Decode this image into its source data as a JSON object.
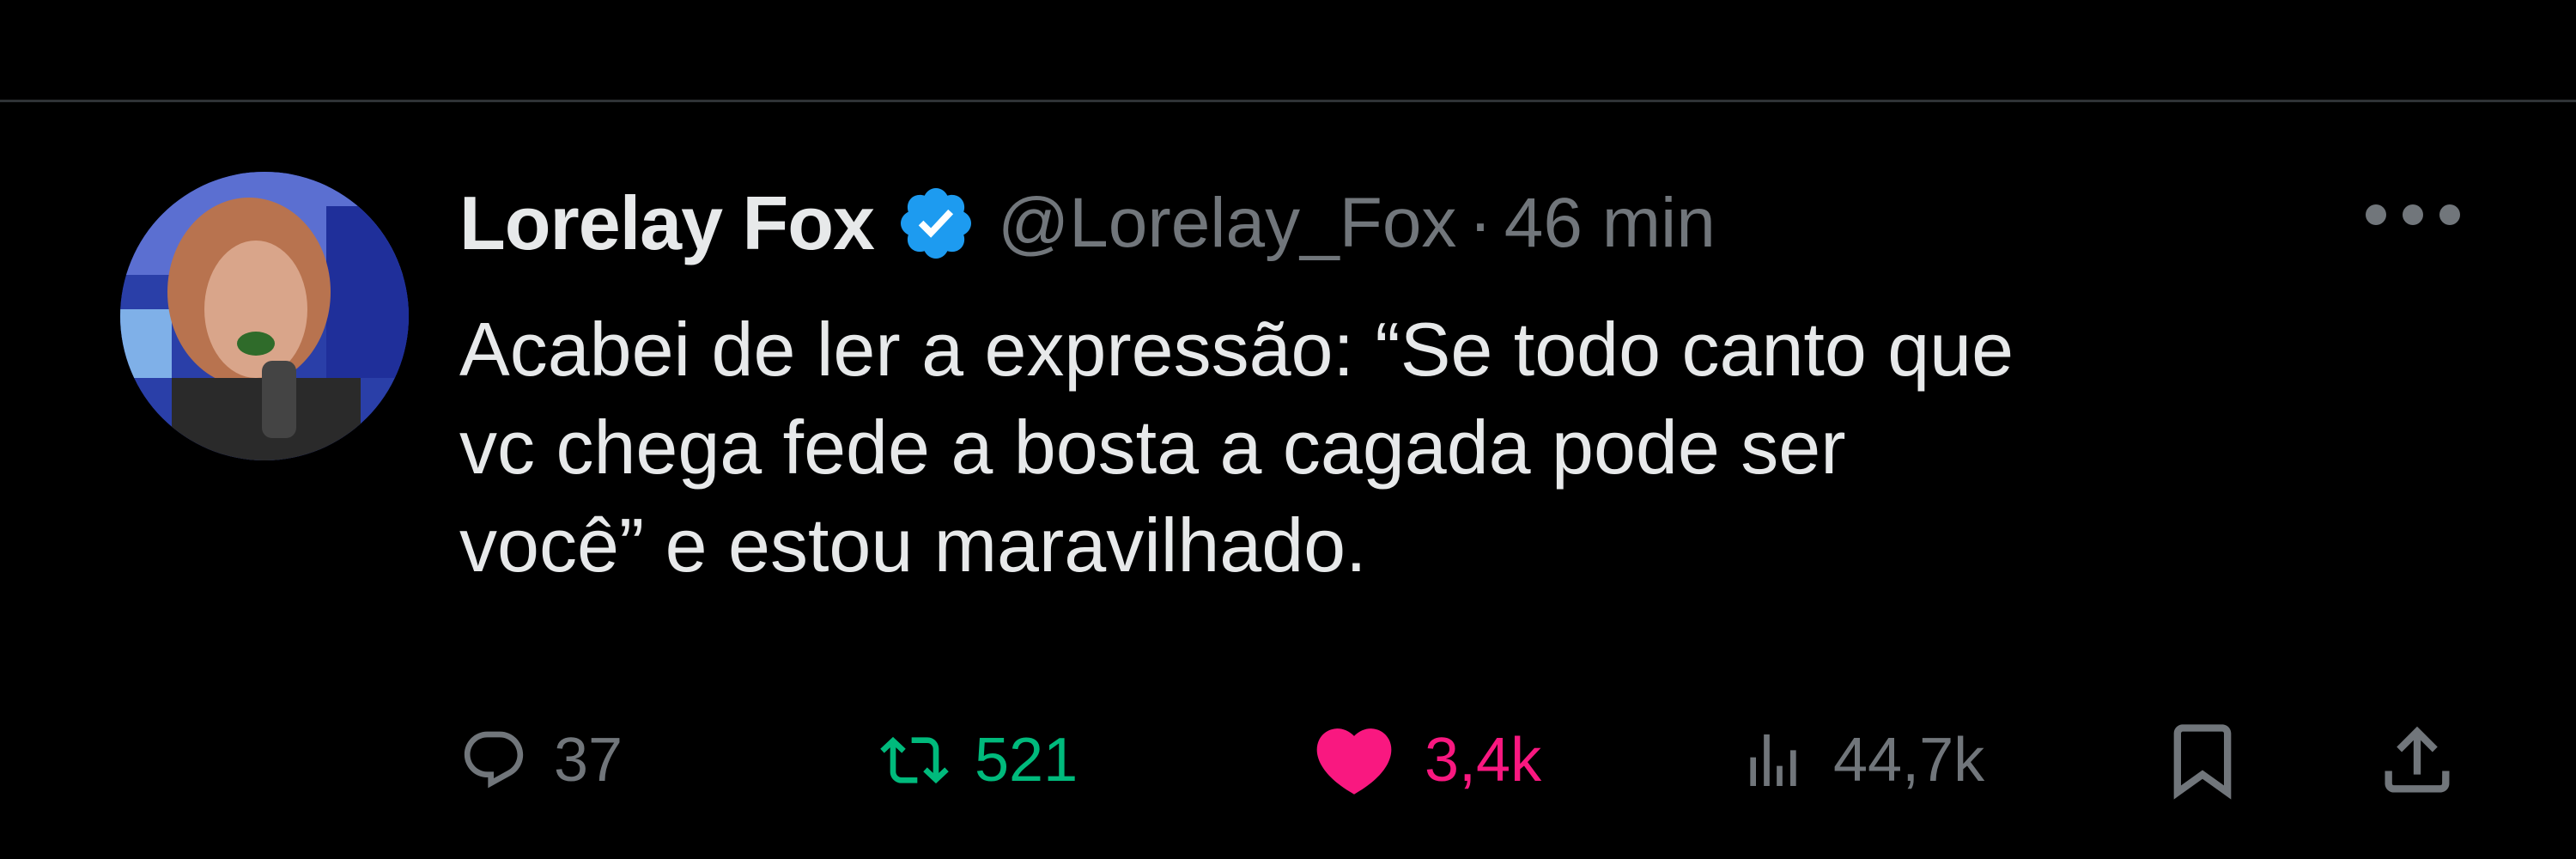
{
  "tweet": {
    "author_name": "Lorelay Fox",
    "handle": "@Lorelay_Fox",
    "separator": "·",
    "time": "46 min",
    "text_lines": [
      "Acabei de ler a expressão: “Se todo canto que",
      "vc chega fede a bosta a cagada pode ser",
      "você” e estou maravilhado."
    ]
  },
  "actions": {
    "replies": "37",
    "retweets": "521",
    "likes": "3,4k",
    "views": "44,7k"
  },
  "icons": {
    "verified": "verified-badge-icon",
    "more": "more-options-icon",
    "reply": "reply-icon",
    "retweet": "retweet-icon",
    "like": "heart-icon",
    "views": "analytics-icon",
    "bookmark": "bookmark-icon",
    "share": "share-icon"
  },
  "colors": {
    "background": "#000000",
    "text": "#e7e9ea",
    "muted": "#71767b",
    "verified": "#1d9bf0",
    "retweet": "#00ba7c",
    "like": "#f91880"
  }
}
